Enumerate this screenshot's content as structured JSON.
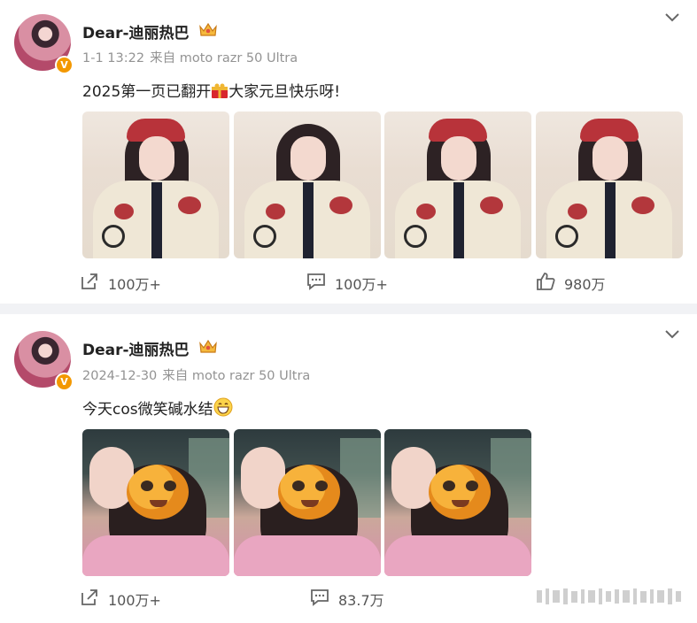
{
  "posts": [
    {
      "author": "Dear-迪丽热巴",
      "verified_badge": "V",
      "time": "1-1 13:22",
      "source": "来自 moto razr 50 Ultra",
      "text_before": "2025第一页已翻开",
      "text_after": "大家元旦快乐呀!",
      "emoji": "red-gift-icon",
      "photos": [
        "photo-1",
        "photo-2",
        "photo-3",
        "photo-4"
      ],
      "repost_count": "100万+",
      "comment_count": "100万+",
      "like_count": "980万"
    },
    {
      "author": "Dear-迪丽热巴",
      "verified_badge": "V",
      "time": "2024-12-30",
      "source": "来自 moto razr 50 Ultra",
      "text": "今天cos微笑碱水结",
      "emoji": "grin-icon",
      "photos": [
        "photo-1",
        "photo-2",
        "photo-3"
      ],
      "repost_count": "100万+",
      "comment_count": "83.7万"
    }
  ],
  "colors": {
    "badge": "#f39800",
    "meta_text": "#939393",
    "divider": "#f1f2f5"
  }
}
